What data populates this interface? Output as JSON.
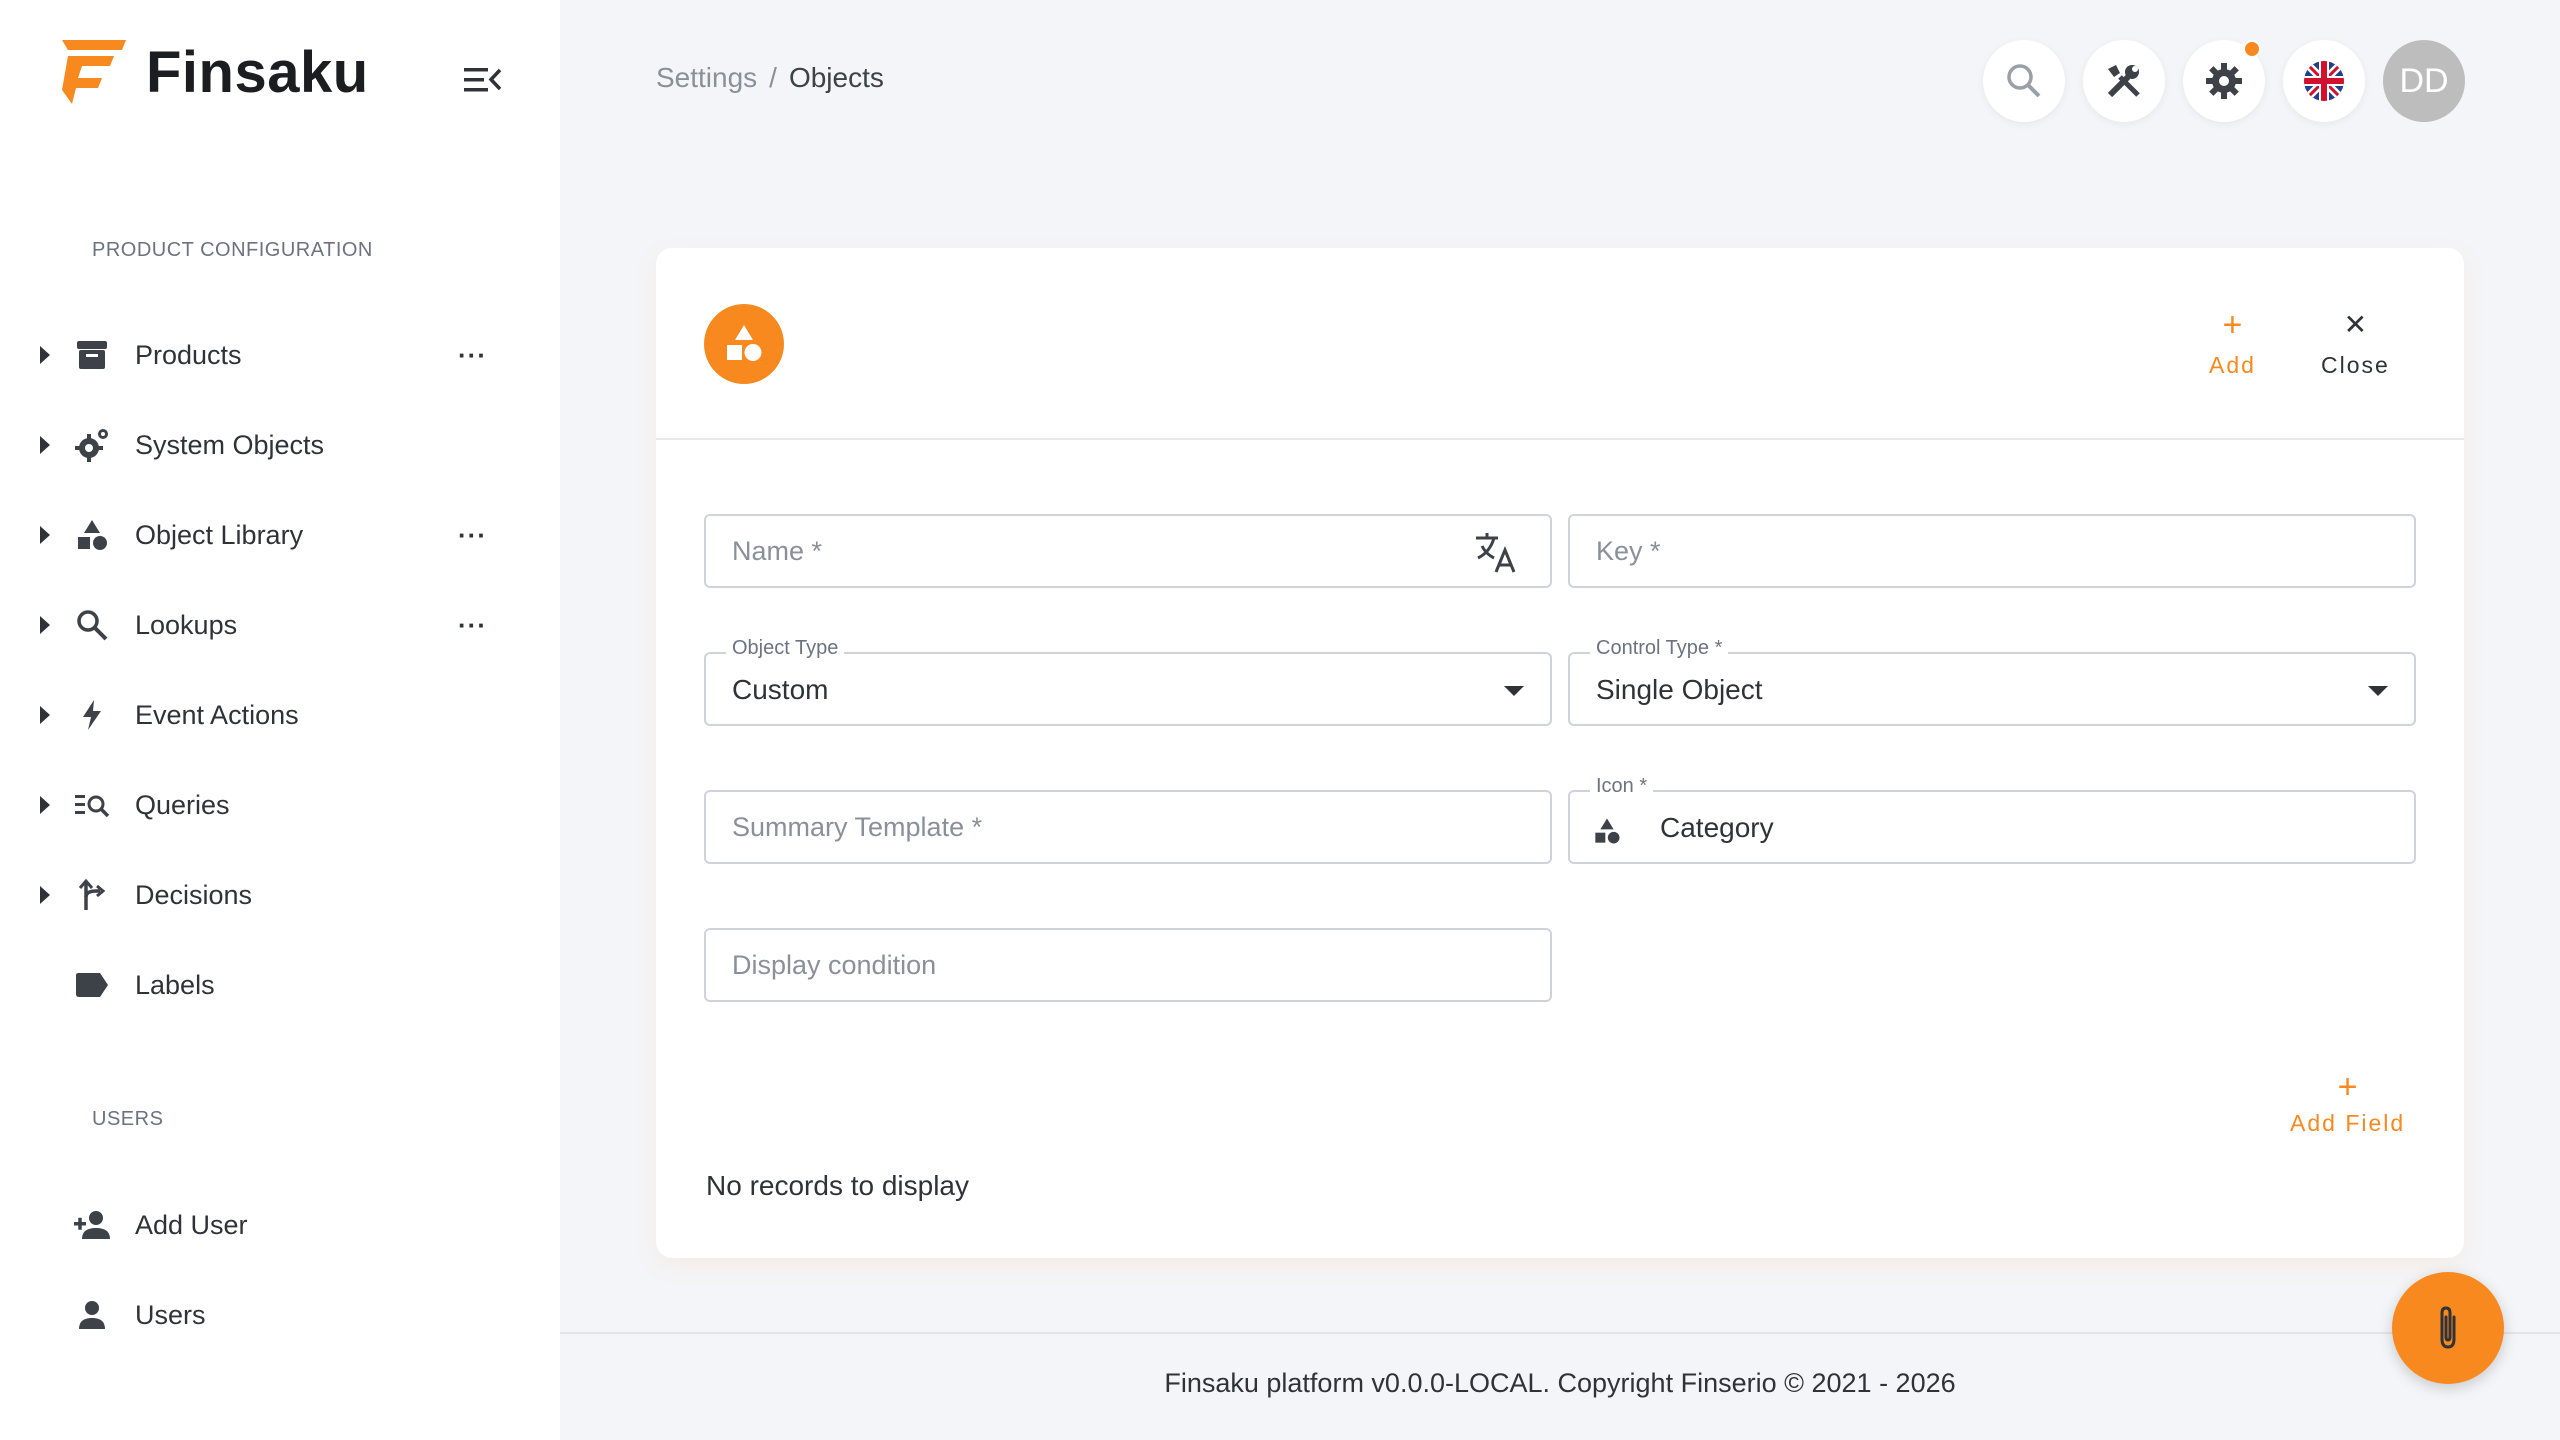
{
  "app": {
    "name": "Finsaku"
  },
  "colors": {
    "accent": "#f7891f",
    "text": "#2f3338",
    "muted": "#8a909a",
    "bg": "#f4f5f8"
  },
  "sidebar": {
    "section_product": "PRODUCT CONFIGURATION",
    "section_users": "USERS",
    "items": [
      {
        "label": "Products",
        "icon": "archive-icon",
        "more": "···"
      },
      {
        "label": "System Objects",
        "icon": "cogs-icon"
      },
      {
        "label": "Object Library",
        "icon": "category-icon",
        "more": "···"
      },
      {
        "label": "Lookups",
        "icon": "search-icon",
        "more": "···"
      },
      {
        "label": "Event Actions",
        "icon": "bolt-icon"
      },
      {
        "label": "Queries",
        "icon": "query-icon"
      },
      {
        "label": "Decisions",
        "icon": "decision-icon"
      },
      {
        "label": "Labels",
        "icon": "label-icon"
      }
    ],
    "user_items": [
      {
        "label": "Add User",
        "icon": "person-add-icon"
      },
      {
        "label": "Users",
        "icon": "person-icon"
      }
    ]
  },
  "breadcrumb": {
    "root": "Settings",
    "separator": "/",
    "current": "Objects"
  },
  "header": {
    "avatar_initials": "DD"
  },
  "card": {
    "actions": {
      "add_symbol": "+",
      "add_label": "Add",
      "close_symbol": "✕",
      "close_label": "Close"
    },
    "fields": {
      "name_placeholder": "Name *",
      "key_placeholder": "Key *",
      "object_type_label": "Object Type",
      "object_type_value": "Custom",
      "control_type_label": "Control Type *",
      "control_type_value": "Single Object",
      "summary_placeholder": "Summary Template *",
      "icon_label": "Icon *",
      "icon_value": "Category",
      "display_condition_placeholder": "Display condition"
    },
    "add_field_symbol": "+",
    "add_field_label": "Add Field",
    "empty_text": "No records to display"
  },
  "footer": {
    "text": "Finsaku platform v0.0.0-LOCAL. Copyright Finserio © 2021 - 2026"
  }
}
